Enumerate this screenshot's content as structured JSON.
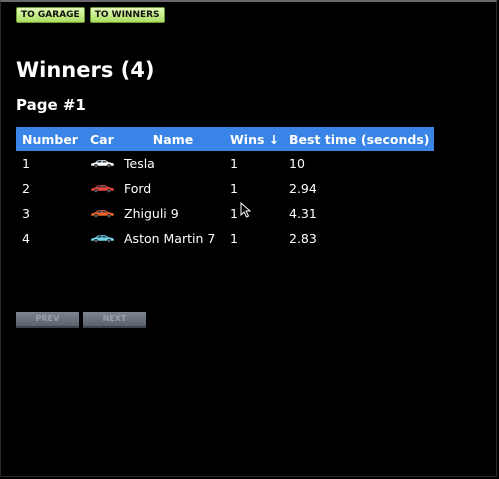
{
  "nav": {
    "garage_label": "TO GARAGE",
    "winners_label": "TO WINNERS"
  },
  "title": "Winners (4)",
  "page_label": "Page #1",
  "table": {
    "headers": {
      "number": "Number",
      "car": "Car",
      "name": "Name",
      "wins": "Wins ↓",
      "best_time": "Best time (seconds)"
    },
    "rows": [
      {
        "number": "1",
        "name": "Tesla",
        "wins": "1",
        "time": "10",
        "car_color": "#ffffff"
      },
      {
        "number": "2",
        "name": "Ford",
        "wins": "1",
        "time": "2.94",
        "car_color": "#e8453c"
      },
      {
        "number": "3",
        "name": "Zhiguli 9",
        "wins": "1",
        "time": "4.31",
        "car_color": "#e8642c"
      },
      {
        "number": "4",
        "name": "Aston Martin 7",
        "wins": "1",
        "time": "2.83",
        "car_color": "#6fd4e8"
      }
    ]
  },
  "pagination": {
    "prev_label": "PREV",
    "next_label": "NEXT"
  },
  "icons": {
    "car": "car-icon",
    "cursor": "mouse-cursor-icon"
  }
}
